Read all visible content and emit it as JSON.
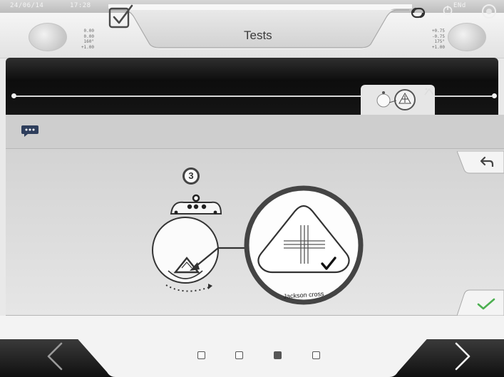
{
  "window": {
    "title": "Tests"
  },
  "status_strip": {
    "left_text": "24/06/14",
    "left_time": "17:28",
    "right_text": "ENd"
  },
  "left_eye": {
    "sphere": "0.00",
    "cylinder": "0.00",
    "axis": "160°",
    "add": "+1.00"
  },
  "right_eye": {
    "sphere": "+0.75",
    "cylinder": "-0.75",
    "axis": "175°",
    "add": "+1.00"
  },
  "icons": {
    "title": "checkbox-icon",
    "header_right": "link-icon",
    "chat": "chat-icon",
    "back": "back-arrow-icon",
    "confirm": "checkmark-icon",
    "prev": "chevron-left-icon",
    "next": "chevron-right-icon"
  },
  "colors": {
    "confirm_green": "#4caf50",
    "dark_bar": "#111111",
    "chat_icon": "#2e3e5c"
  },
  "instruction": {
    "step_number": "3",
    "test_label": "Jackson cross"
  },
  "pagination": {
    "pages": 4,
    "current": 3
  }
}
